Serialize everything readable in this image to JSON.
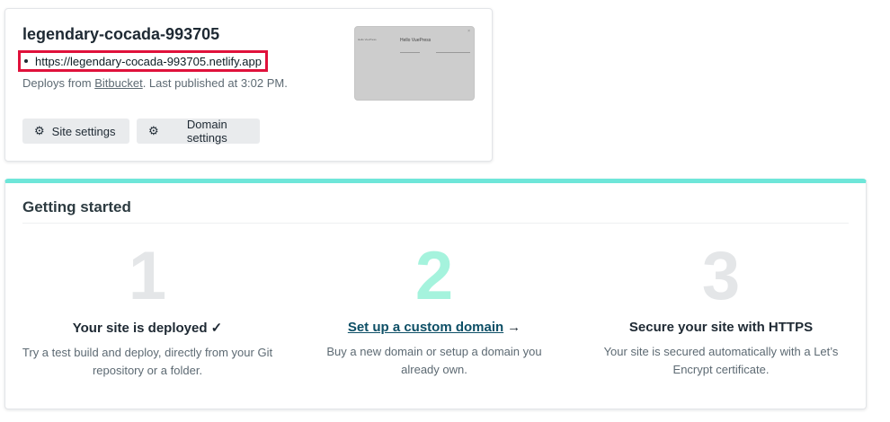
{
  "site": {
    "name": "legendary-cocada-993705",
    "url": "https://legendary-cocada-993705.netlify.app",
    "deploy_prefix": "Deploys from ",
    "deploy_provider": "Bitbucket",
    "deploy_suffix": ". Last published at 3:02 PM.",
    "buttons": {
      "site_settings": "Site settings",
      "domain_settings": "Domain settings"
    },
    "thumbnail": {
      "brand": "Hello VuePress",
      "title": "Hello VuePress"
    },
    "highlight_color": "#e0113b"
  },
  "getting_started": {
    "title": "Getting started",
    "accent_color": "#6ee6d9",
    "steps": [
      {
        "number": "1",
        "heading": "Your site is deployed ✓",
        "text": "Try a test build and deploy, directly from your Git repository or a folder."
      },
      {
        "number": "2",
        "heading": "Set up a custom domain",
        "arrow": "→",
        "text": "Buy a new domain or setup a domain you already own."
      },
      {
        "number": "3",
        "heading": "Secure your site with HTTPS",
        "text": "Your site is secured automatically with a Let’s Encrypt certificate."
      }
    ]
  },
  "icons": {
    "gear": "gear-icon",
    "thumbnail_close": "close-icon"
  }
}
